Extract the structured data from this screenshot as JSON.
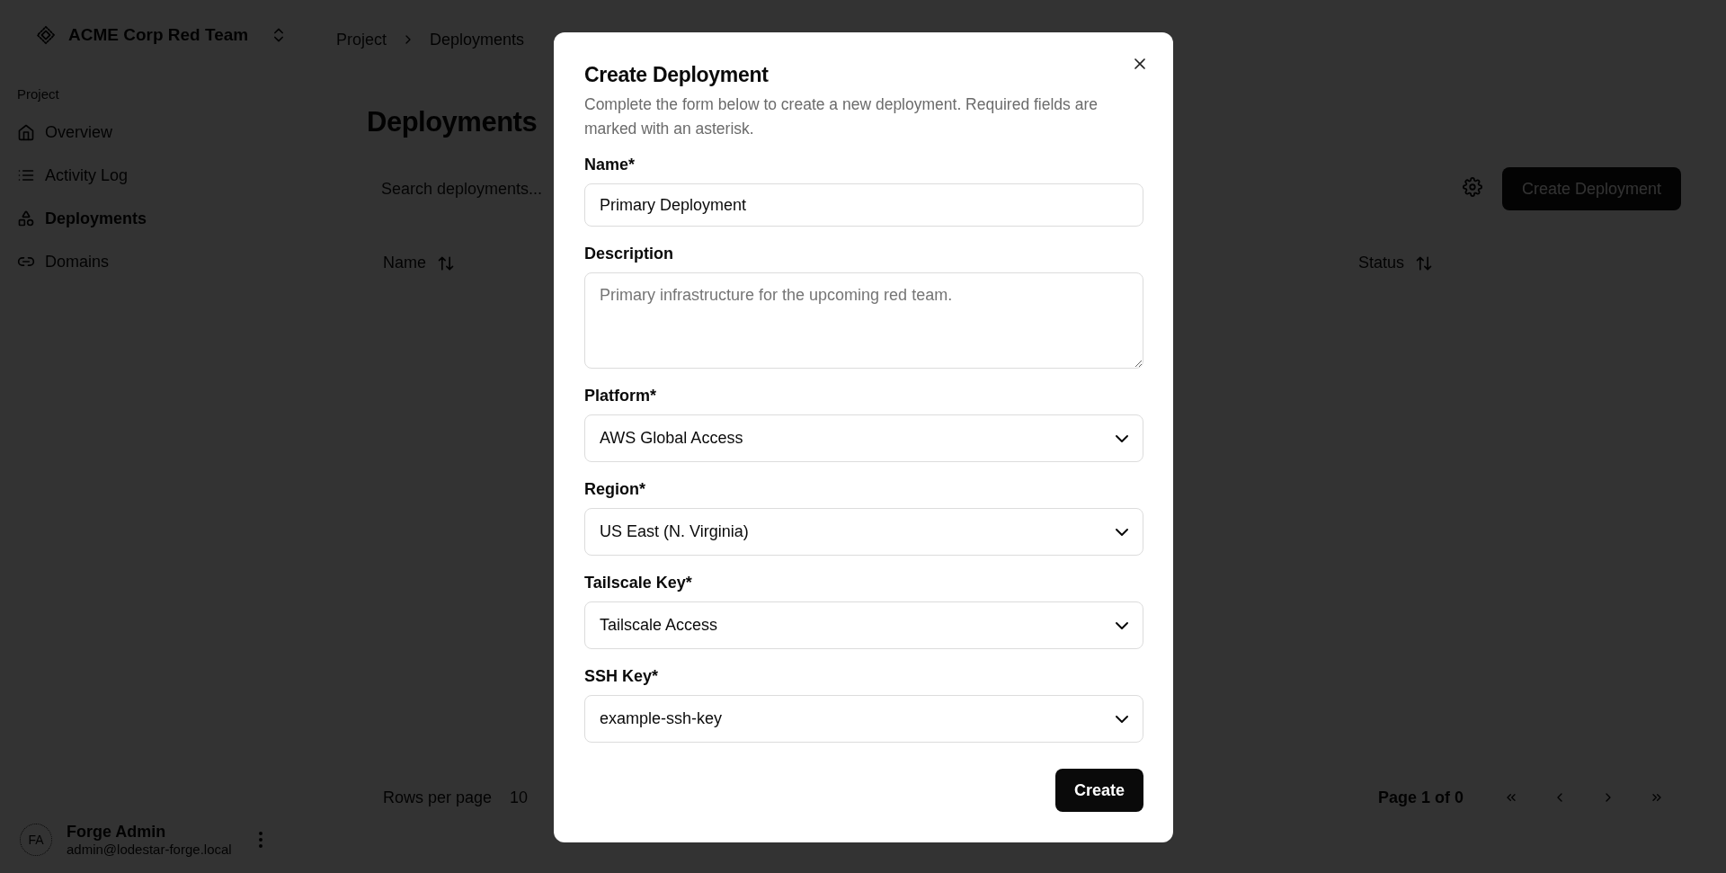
{
  "team_switcher": {
    "name": "ACME Corp Red Team"
  },
  "breadcrumb": [
    "Project",
    "Deployments"
  ],
  "sidebar": {
    "section": "Project",
    "items": [
      {
        "label": "Overview",
        "selected": false
      },
      {
        "label": "Activity Log",
        "selected": false
      },
      {
        "label": "Deployments",
        "selected": true
      },
      {
        "label": "Domains",
        "selected": false
      }
    ]
  },
  "user": {
    "initials": "FA",
    "name": "Forge Admin",
    "email": "admin@lodestar-forge.local"
  },
  "page": {
    "title": "Deployments",
    "search": {
      "placeholder": "Search deployments..."
    },
    "create_button": "Create Deployment",
    "table": {
      "columns": [
        "Name",
        "Status"
      ]
    },
    "pagination": {
      "rows_per_page_label": "Rows per page",
      "rows_per_page": "10",
      "page_info": "Page 1 of 0"
    }
  },
  "dialog": {
    "title": "Create Deployment",
    "description": "Complete the form below to create a new deployment. Required fields are marked with an asterisk.",
    "fields": [
      {
        "kind": "text",
        "label": "Name*",
        "value": "Primary Deployment"
      },
      {
        "kind": "textarea",
        "label": "Description",
        "placeholder": "Primary infrastructure for the upcoming red team."
      },
      {
        "kind": "select",
        "label": "Platform*",
        "value": "AWS Global Access"
      },
      {
        "kind": "select",
        "label": "Region*",
        "value": "US East (N. Virginia)"
      },
      {
        "kind": "select",
        "label": "Tailscale Key*",
        "value": "Tailscale Access"
      },
      {
        "kind": "select",
        "label": "SSH Key*",
        "value": "example-ssh-key"
      }
    ],
    "submit": "Create"
  }
}
